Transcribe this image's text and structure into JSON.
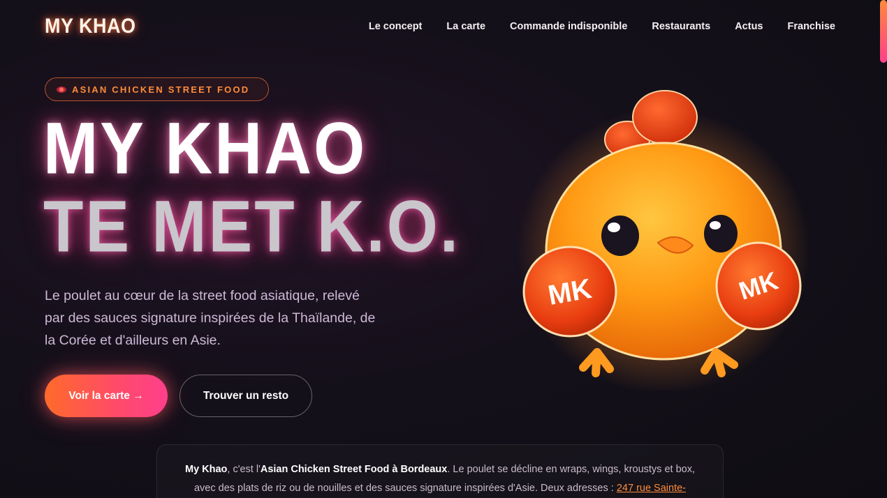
{
  "nav": {
    "logo": "MY KHAO",
    "items": [
      {
        "label": "Le concept"
      },
      {
        "label": "La carte"
      },
      {
        "label": "Commande indisponible"
      },
      {
        "label": "Restaurants"
      },
      {
        "label": "Actus"
      },
      {
        "label": "Franchise"
      }
    ]
  },
  "hero": {
    "badge": "ASIAN CHICKEN STREET FOOD",
    "badge_icon": "chili-icon",
    "title_line1": "MY KHAO",
    "title_line2": "TE MET K.O.",
    "lead": "Le poulet au cœur de la street food asiatique, relevé par des sauces signature inspirées de la Thaïlande, de la Corée et d'ailleurs en Asie.",
    "primary_button": "Voir la carte →",
    "secondary_button": "Trouver un resto",
    "mascot_glove_text": "MK"
  },
  "info": {
    "brand": "My Khao",
    "text1": ", c'est l'",
    "highlight": "Asian Chicken Street Food à Bordeaux",
    "text2": ". Le poulet se décline en wraps, wings, kroustys et box, avec des plats de riz ou de nouilles et des sauces signature inspirées d'Asie. Deux adresses : ",
    "link": "247 rue Sainte-"
  },
  "colors": {
    "accent_orange": "#ff8c3a",
    "accent_pink": "#ff3f8c",
    "background": "#14101a"
  }
}
